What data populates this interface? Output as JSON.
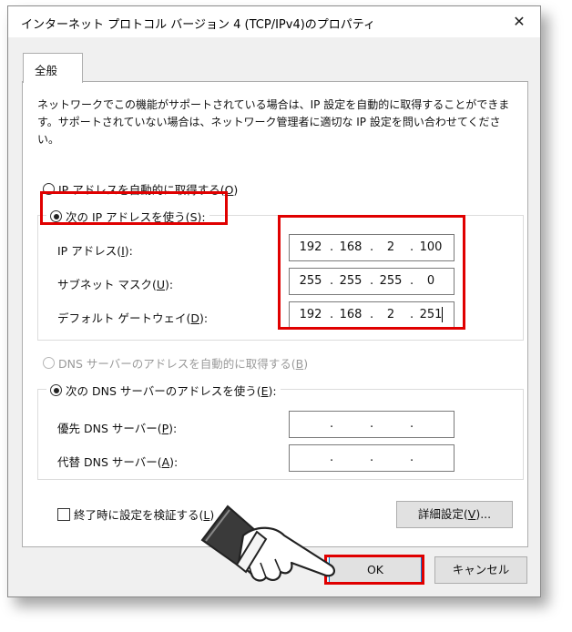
{
  "window": {
    "title": "インターネット プロトコル バージョン 4 (TCP/IPv4)のプロパティ",
    "close_glyph": "✕"
  },
  "tab": {
    "label": "全般"
  },
  "description": "ネットワークでこの機能がサポートされている場合は、IP 設定を自動的に取得することができます。サポートされていない場合は、ネットワーク管理者に適切な IP 設定を問い合わせてください。",
  "ip_section": {
    "auto_option": {
      "label": "IP アドレスを自動的に取得する(",
      "key": "O",
      "suffix": ")",
      "selected": false
    },
    "manual_option": {
      "label": "次の IP アドレスを使う(",
      "key": "S",
      "suffix": "):",
      "selected": true
    },
    "fields": [
      {
        "label": "IP アドレス(",
        "key": "I",
        "suffix": "):",
        "octets": [
          "192",
          "168",
          "2",
          "100"
        ]
      },
      {
        "label": "サブネット マスク(",
        "key": "U",
        "suffix": "):",
        "octets": [
          "255",
          "255",
          "255",
          "0"
        ]
      },
      {
        "label": "デフォルト ゲートウェイ(",
        "key": "D",
        "suffix": "):",
        "octets": [
          "192",
          "168",
          "2",
          "251"
        ]
      }
    ]
  },
  "dns_section": {
    "auto_option": {
      "label": "DNS サーバーのアドレスを自動的に取得する(",
      "key": "B",
      "suffix": ")",
      "selected": false,
      "disabled": true
    },
    "manual_option": {
      "label": "次の DNS サーバーのアドレスを使う(",
      "key": "E",
      "suffix": "):",
      "selected": true
    },
    "fields": [
      {
        "label": "優先 DNS サーバー(",
        "key": "P",
        "suffix": "):",
        "octets": [
          "",
          "",
          "",
          ""
        ]
      },
      {
        "label": "代替 DNS サーバー(",
        "key": "A",
        "suffix": "):",
        "octets": [
          "",
          "",
          "",
          ""
        ]
      }
    ]
  },
  "validate_checkbox": {
    "label": "終了時に設定を検証する(",
    "key": "L",
    "suffix": ")",
    "checked": false
  },
  "advanced_button": {
    "label": "詳細設定(",
    "key": "V",
    "suffix": ")..."
  },
  "ok_button": {
    "label": "OK"
  },
  "cancel_button": {
    "label": "キャンセル"
  },
  "colors": {
    "highlight": "#e00000",
    "focus": "#0078d7"
  },
  "icons": {
    "pointer": "pointing-hand-icon",
    "close": "close-icon"
  }
}
